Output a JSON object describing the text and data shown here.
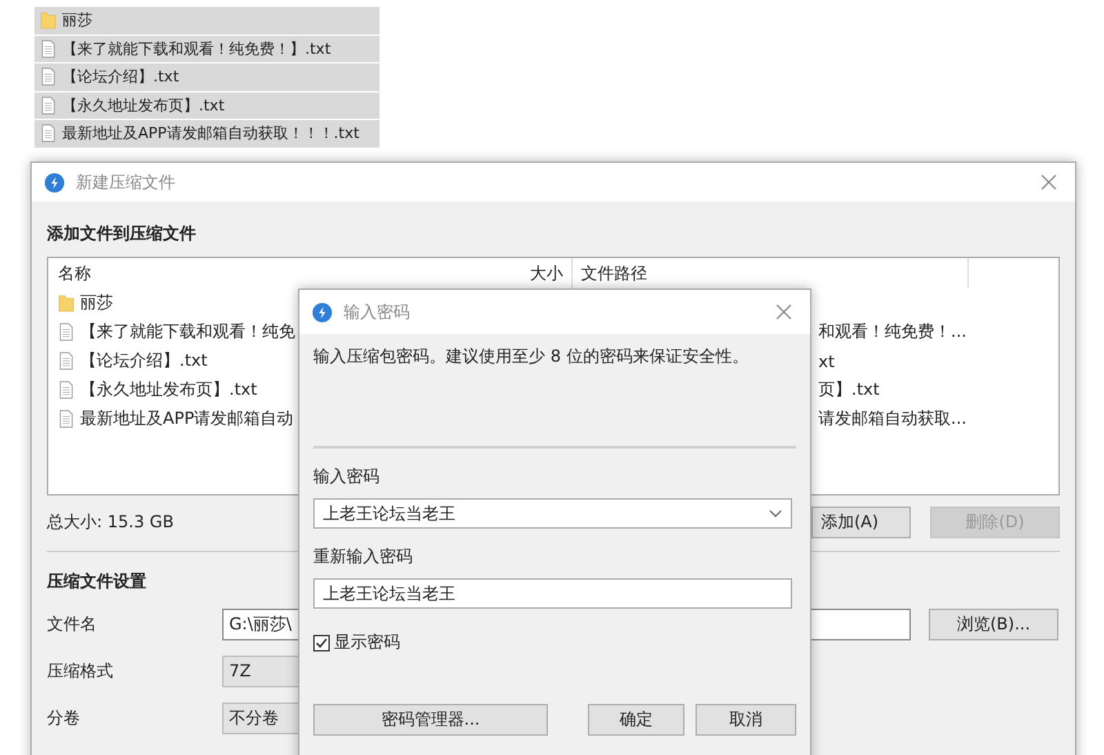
{
  "drag_list": [
    {
      "kind": "folder",
      "name": "丽莎"
    },
    {
      "kind": "file",
      "name": "【来了就能下载和观看！纯免费！】.txt"
    },
    {
      "kind": "file",
      "name": "【论坛介绍】.txt"
    },
    {
      "kind": "file",
      "name": "【永久地址发布页】.txt"
    },
    {
      "kind": "file",
      "name": "最新地址及APP请发邮箱自动获取！！！.txt"
    }
  ],
  "main_window": {
    "title": "新建压缩文件",
    "section_title": "添加文件到压缩文件",
    "columns": [
      "名称",
      "大小",
      "文件路径"
    ],
    "rows": [
      {
        "kind": "folder",
        "name": "丽莎"
      },
      {
        "kind": "file",
        "name": "【来了就能下载和观看！纯免",
        "path": "和观看！纯免费！..."
      },
      {
        "kind": "file",
        "name": "【论坛介绍】.txt",
        "path": "xt"
      },
      {
        "kind": "file",
        "name": "【永久地址发布页】.txt",
        "path": "页】.txt"
      },
      {
        "kind": "file",
        "name": "最新地址及APP请发邮箱自动",
        "path": "请发邮箱自动获取..."
      }
    ],
    "total_size": "总大小: 15.3 GB",
    "buttons": [
      {
        "label": "添加(A)",
        "disabled": false
      },
      {
        "label": "删除(D)",
        "disabled": true
      }
    ],
    "settings_title": "压缩文件设置",
    "settings": [
      {
        "label": "文件名",
        "value": "G:\\丽莎\\",
        "kind": "input"
      },
      {
        "label": "压缩格式",
        "value": "7Z",
        "kind": "select"
      },
      {
        "label": "分卷",
        "value": "不分卷",
        "kind": "select"
      }
    ],
    "browse_button": "浏览(B)..."
  },
  "password_dialog": {
    "title": "输入密码",
    "message": "输入压缩包密码。建议使用至少 8 位的密码来保证安全性。",
    "password_label": "输入密码",
    "password_value": "上老王论坛当老王",
    "confirm_label": "重新输入密码",
    "confirm_value": "上老王论坛当老王",
    "show_password": {
      "label": "显示密码",
      "checked": true
    },
    "buttons": [
      "密码管理器...",
      "确定",
      "取消"
    ]
  }
}
